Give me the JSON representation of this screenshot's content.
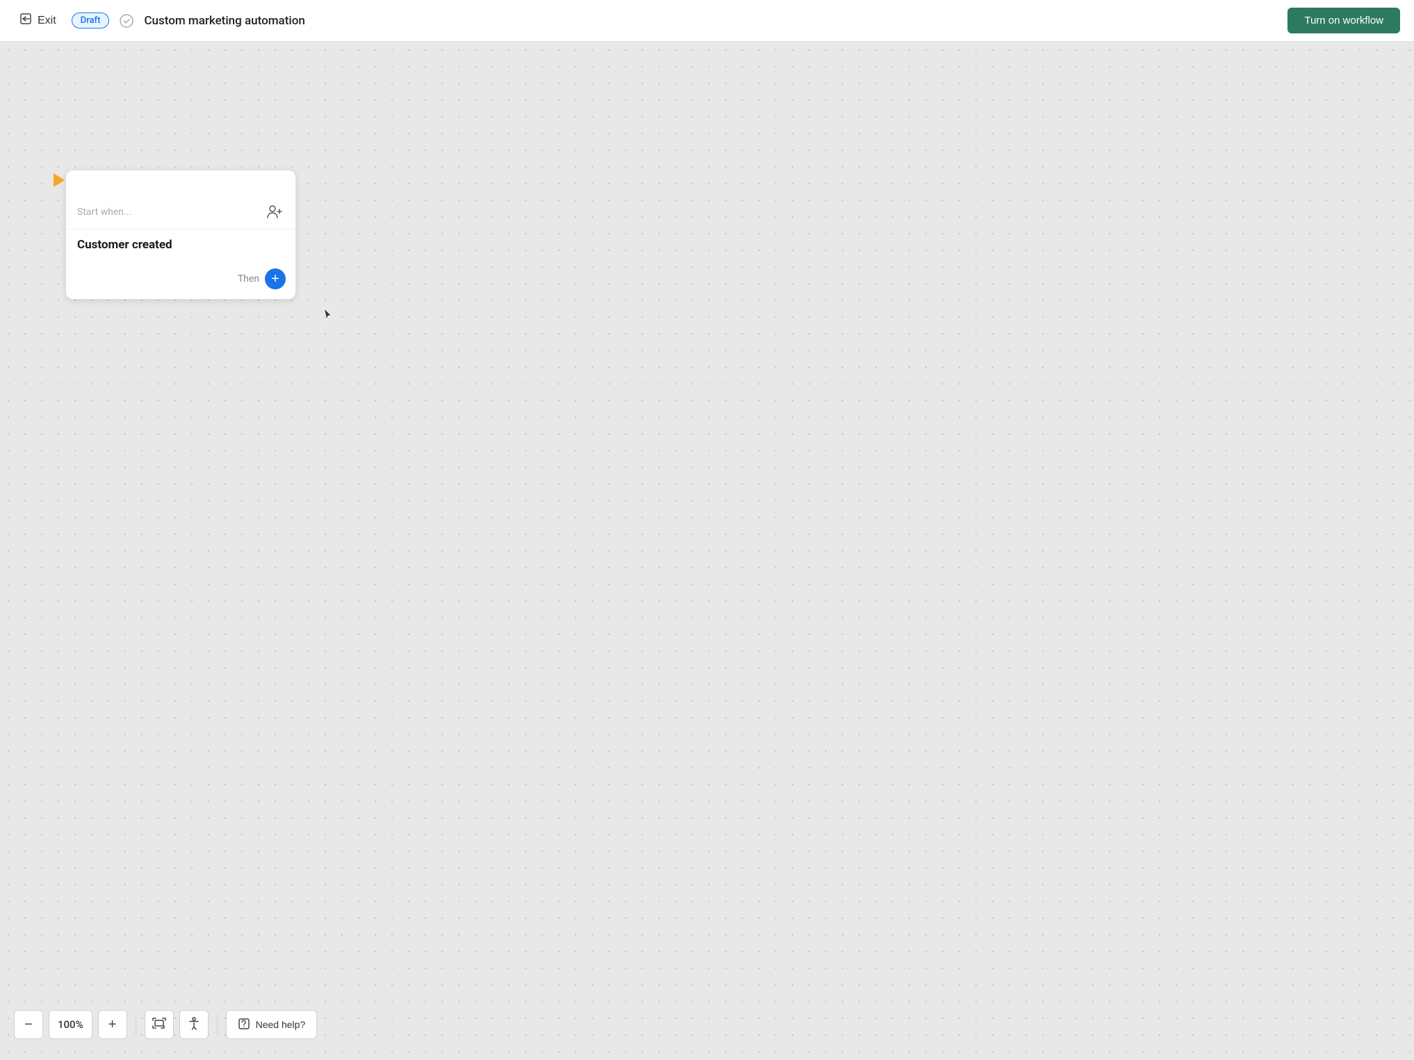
{
  "header": {
    "exit_label": "Exit",
    "draft_label": "Draft",
    "page_title": "Custom marketing automation",
    "turn_on_label": "Turn on workflow"
  },
  "workflow_card": {
    "start_when_label": "Start when...",
    "trigger_label": "Customer created",
    "then_label": "Then"
  },
  "bottom_toolbar": {
    "zoom_minus_label": "−",
    "zoom_level": "100%",
    "zoom_plus_label": "+",
    "fit_icon": "⇔",
    "accessibility_icon": "♿",
    "need_help_label": "Need help?"
  },
  "colors": {
    "turn_on_bg": "#2d7a5e",
    "draft_border": "#1a73e8",
    "add_btn_bg": "#1a73e8",
    "play_icon_color": "#f5a623"
  }
}
